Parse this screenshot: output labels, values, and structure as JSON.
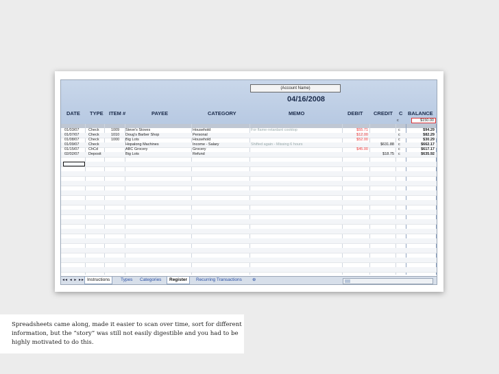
{
  "sheet": {
    "account_name": "(Account Name)",
    "date": "04/16/2008",
    "columns": [
      "DATE",
      "TYPE",
      "ITEM #",
      "PAYEE",
      "CATEGORY",
      "MEMO",
      "DEBIT",
      "CREDIT",
      "C",
      "BALANCE"
    ],
    "starting_c": "c",
    "starting_balance": "$150.00",
    "rows": [
      {
        "date": "01/03/07",
        "type": "Check",
        "item": "1009",
        "payee": "Steve's Stoves",
        "category": "Household",
        "memo": "For flame-retardant cooktop",
        "debit": "$55.71",
        "credit": "",
        "c": "c",
        "balance": "$94.29"
      },
      {
        "date": "01/07/07",
        "type": "Check",
        "item": "1010",
        "payee": "Doug's Barber Shop",
        "category": "Personal",
        "memo": "",
        "debit": "$12.00",
        "credit": "",
        "c": "c",
        "balance": "$82.29"
      },
      {
        "date": "01/08/07",
        "type": "Check",
        "item": "1000",
        "payee": "Big Lots",
        "category": "Household",
        "memo": "",
        "debit": "$52.00",
        "credit": "",
        "c": "c",
        "balance": "$30.29"
      },
      {
        "date": "01/09/07",
        "type": "Check",
        "item": "",
        "payee": "Hopalong Machines",
        "category": "Income - Salary",
        "memo": "Shifted again - Missing 6 hours",
        "debit": "",
        "credit": "$631.88",
        "c": "c",
        "balance": "$662.17"
      },
      {
        "date": "01/15/07",
        "type": "ChCd",
        "item": "",
        "payee": "ABC Grocery",
        "category": "Grocery",
        "memo": "",
        "debit": "$45.00",
        "credit": "",
        "c": "c",
        "balance": "$617.17"
      },
      {
        "date": "02/02/07",
        "type": "Deposit",
        "item": "",
        "payee": "Big Lots",
        "category": "Refund",
        "memo": "",
        "debit": "",
        "credit": "$18.75",
        "c": "c",
        "balance": "$635.92"
      }
    ]
  },
  "tabs": [
    {
      "label": "Instructions",
      "state": "plain"
    },
    {
      "label": "Types",
      "state": "link"
    },
    {
      "label": "Categories",
      "state": "link"
    },
    {
      "label": "Register",
      "state": "active"
    },
    {
      "label": "Recurring Transactions",
      "state": "link"
    }
  ],
  "caption": "Spreadsheets came along, made it easier to scan over time, sort for different information, but the “story” was still not easily digestible and you had to be highly motivated to do this.",
  "colors": {
    "header_band": "#c2d2e8",
    "debit_red": "#e33333",
    "tab_link": "#2a4fa3",
    "background": "#ececec"
  }
}
